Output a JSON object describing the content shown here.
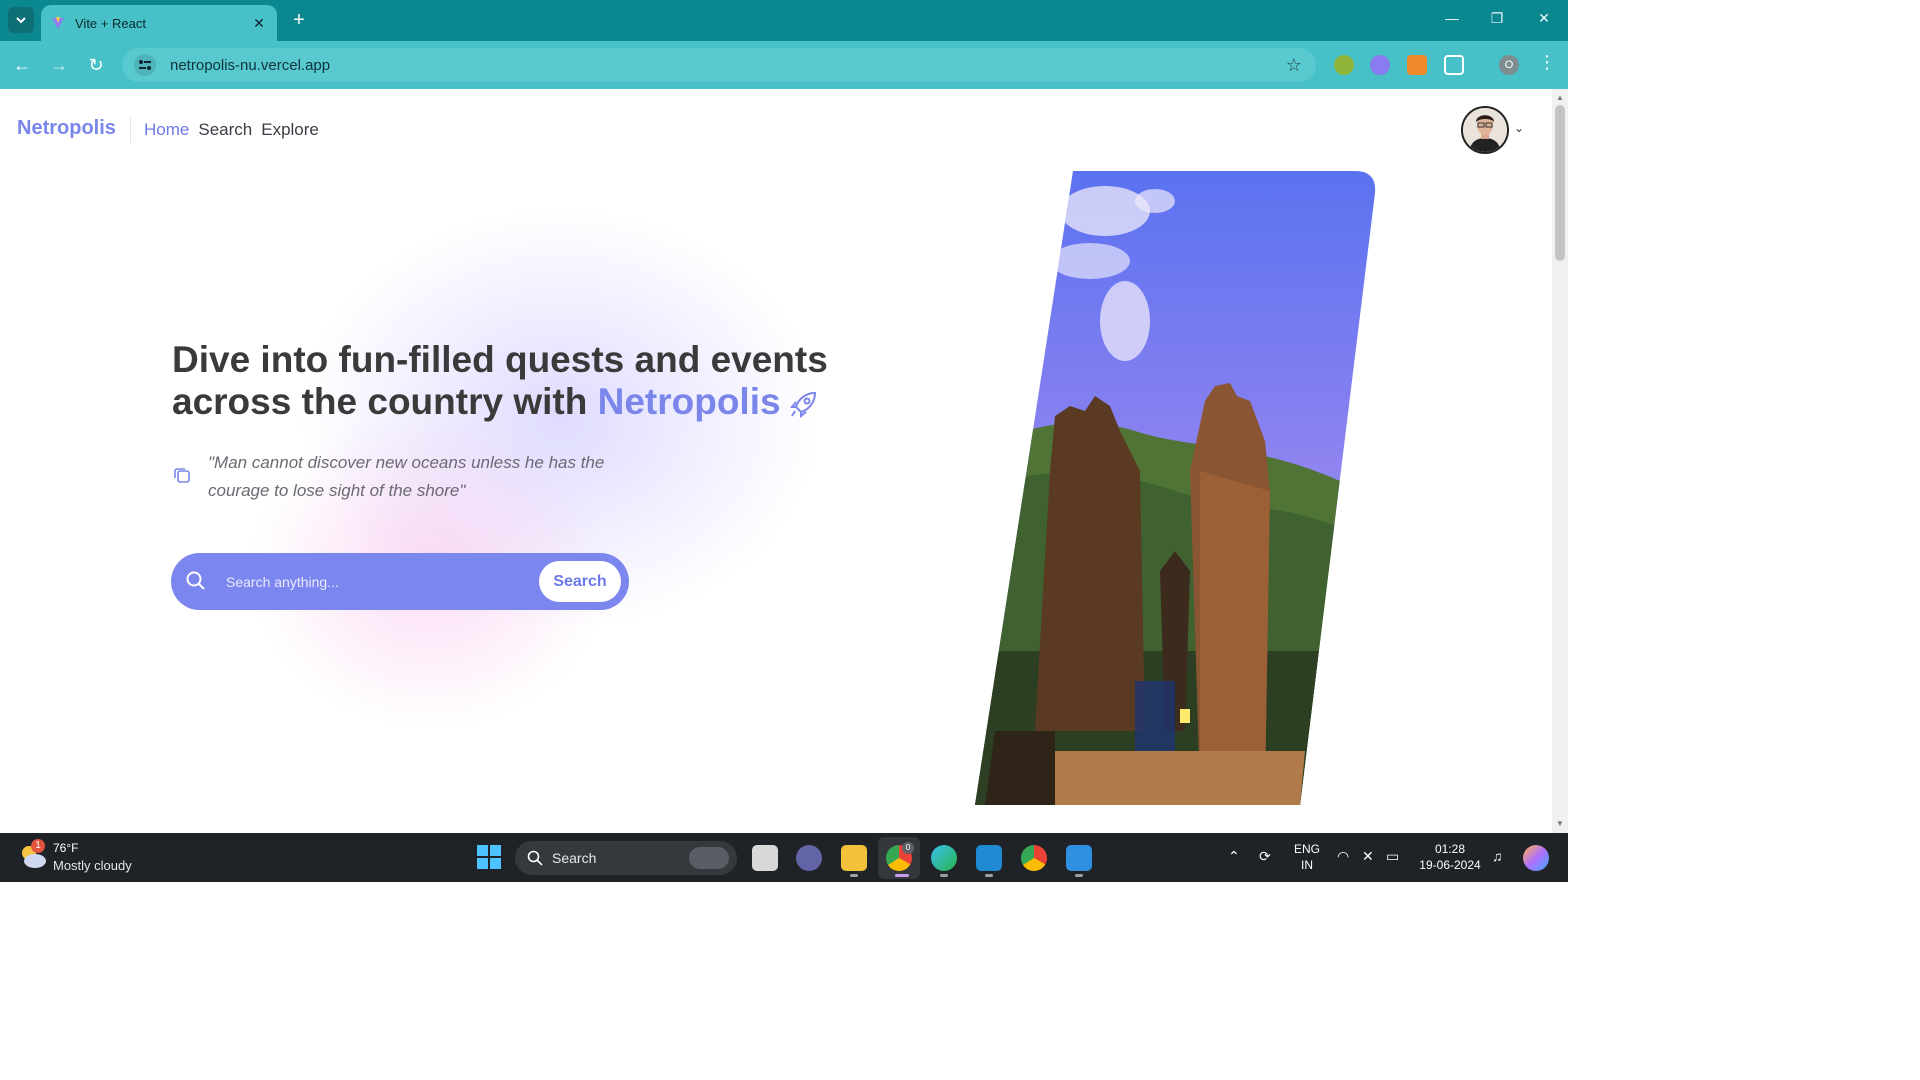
{
  "browser": {
    "tab_title": "Vite + React",
    "url": "netropolis-nu.vercel.app",
    "profile_initial": "O",
    "colors": {
      "tabbar": "#0b8790",
      "toolbar": "#47c1c7"
    }
  },
  "site": {
    "brand": "Netropolis",
    "nav": [
      {
        "label": "Home",
        "active": true
      },
      {
        "label": "Search",
        "active": false
      },
      {
        "label": "Explore",
        "active": false
      }
    ],
    "hero": {
      "headline_part1": "Dive into fun-filled quests and events across the country with ",
      "headline_accent": "Netropolis",
      "quote": "\"Man cannot discover new oceans unless he has the courage to lose sight of the shore\""
    },
    "search": {
      "placeholder": "Search anything...",
      "button_label": "Search"
    },
    "accent_color": "#7a86ea"
  },
  "taskbar": {
    "weather_temp": "76°F",
    "weather_desc": "Mostly cloudy",
    "weather_badge": "1",
    "search_label": "Search",
    "chrome_badge": "0",
    "lang_line1": "ENG",
    "lang_line2": "IN",
    "time": "01:28",
    "date": "19-06-2024"
  }
}
